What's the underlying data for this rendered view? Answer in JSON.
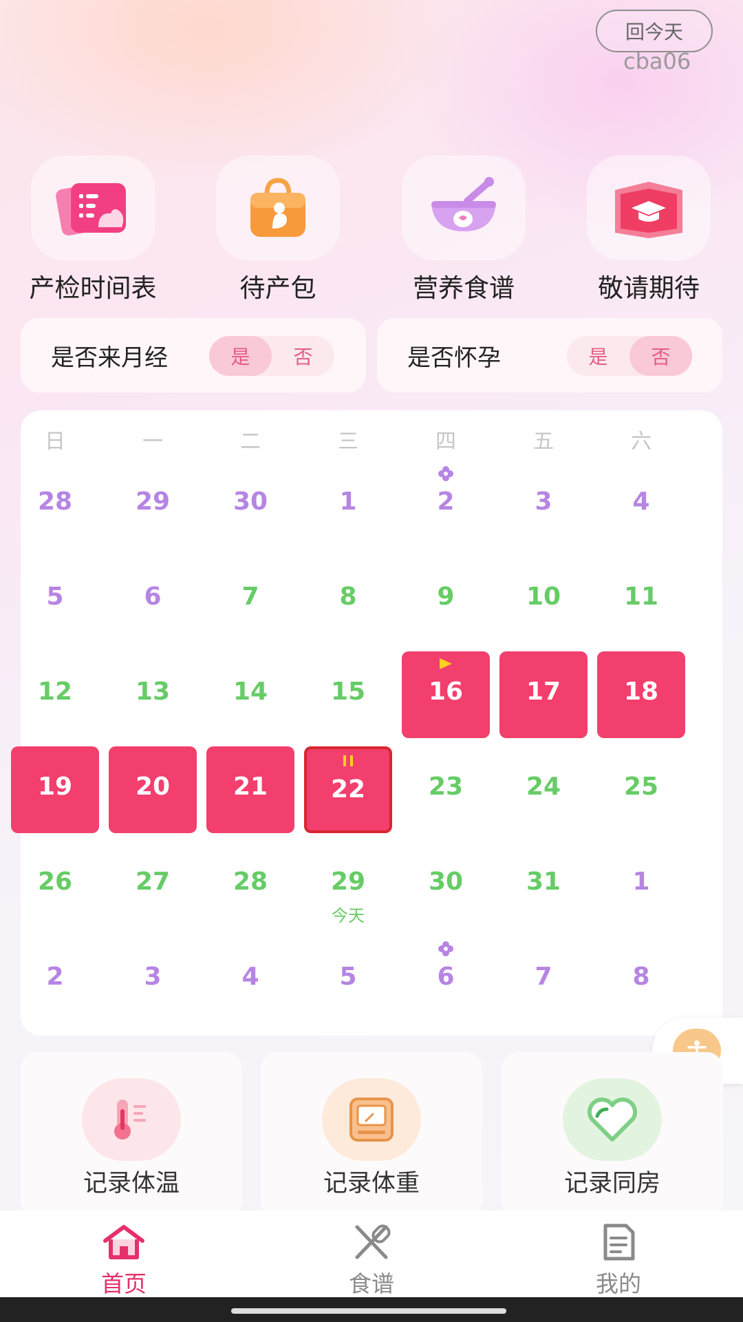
{
  "header": {
    "today_button": "回今天",
    "watermark": "cba06"
  },
  "features": [
    {
      "label": "产检时间表",
      "icon": "schedule-icon"
    },
    {
      "label": "待产包",
      "icon": "bag-icon"
    },
    {
      "label": "营养食谱",
      "icon": "bowl-icon"
    },
    {
      "label": "敬请期待",
      "icon": "graduation-icon"
    }
  ],
  "toggles": [
    {
      "label": "是否来月经",
      "yes": "是",
      "no": "否",
      "selected": "yes"
    },
    {
      "label": "是否怀孕",
      "yes": "是",
      "no": "否",
      "selected": "no"
    }
  ],
  "calendar": {
    "weekdays": [
      "日",
      "一",
      "二",
      "三",
      "四",
      "五",
      "六"
    ],
    "rows": [
      [
        "28",
        "29",
        "30",
        "1",
        "2",
        "3",
        "4"
      ],
      [
        "5",
        "6",
        "7",
        "8",
        "9",
        "10",
        "11"
      ],
      [
        "12",
        "13",
        "14",
        "15",
        "16",
        "17",
        "18"
      ],
      [
        "19",
        "20",
        "21",
        "22",
        "23",
        "24",
        "25"
      ],
      [
        "26",
        "27",
        "28",
        "29",
        "30",
        "31",
        "1"
      ],
      [
        "2",
        "3",
        "4",
        "5",
        "6",
        "7",
        "8"
      ]
    ],
    "today_label": "今天",
    "colors": {
      "purple": "#b685e3",
      "green": "#66cc66",
      "period": "#f23f6d",
      "selected_border": "#d9262f"
    }
  },
  "records": [
    {
      "label": "记录体温",
      "icon": "thermometer-icon"
    },
    {
      "label": "记录体重",
      "icon": "scale-icon"
    },
    {
      "label": "记录同房",
      "icon": "heart-icon"
    }
  ],
  "tabs": [
    {
      "label": "首页",
      "icon": "home-icon",
      "active": true
    },
    {
      "label": "食谱",
      "icon": "utensils-icon",
      "active": false
    },
    {
      "label": "我的",
      "icon": "document-icon",
      "active": false
    }
  ]
}
